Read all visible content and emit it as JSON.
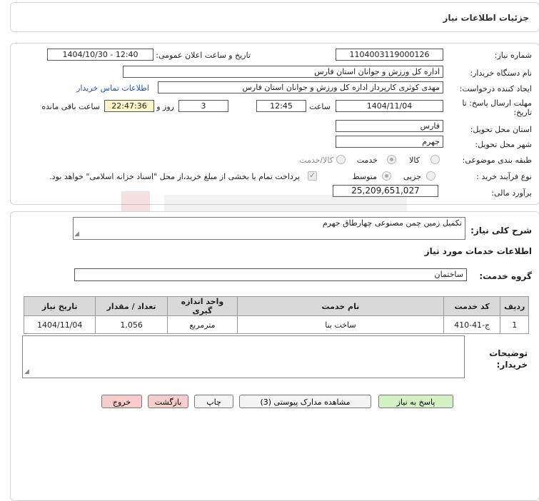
{
  "header": {
    "title": "جزئیات اطلاعات نیاز"
  },
  "form": {
    "need_number_label": "شماره نیاز:",
    "need_number": "1104003119000126",
    "announce_label": "تاریخ و ساعت اعلان عمومی:",
    "announce_value": "1404/10/30 - 12:40",
    "buyer_org_label": "نام دستگاه خریدار:",
    "buyer_org": "اداره کل ورزش و جوانان استان فارس",
    "creator_label": "ایجاد کننده درخواست:",
    "creator": "مهدی کوثری کارپرداز اداره کل ورزش و جوانان استان فارس",
    "contact_link": "اطلاعات تماس خریدار",
    "deadline_label_1": "مهلت ارسال پاسخ: تا",
    "deadline_label_2": "تاریخ:",
    "deadline_date": "1404/11/04",
    "time_label": "ساعت",
    "deadline_time": "12:45",
    "days_value": "3",
    "days_label": "روز و",
    "remaining_time": "22:47:36",
    "remaining_label": "ساعت باقی مانده",
    "province_label": "استان محل تحویل:",
    "province": "فارس",
    "city_label": "شهر محل تحویل:",
    "city": "جهرم",
    "category_label": "طبقه بندی موضوعی:",
    "category_options": [
      "کالا",
      "خدمت",
      "کالا/خدمت"
    ],
    "process_label": "نوع فرآیند خرید :",
    "process_options": [
      "جزیی",
      "متوسط"
    ],
    "payment_note": "پرداخت تمام یا بخشی از مبلغ خرید،از محل \"اسناد خزانه اسلامی\" خواهد بود.",
    "budget_label": "برآورد مالی:",
    "budget": "25,209,651,027"
  },
  "description": {
    "label": "شرح کلی نیاز:",
    "value": "تکمیل زمین چمن مصنوعی چهارطاق جهرم"
  },
  "services": {
    "section_title": "اطلاعات خدمات مورد نیاز",
    "group_label": "گروه خدمت:",
    "group_value": "ساختمان",
    "columns": [
      "ردیف",
      "کد خدمت",
      "نام خدمت",
      "واحد اندازه گیری",
      "تعداد / مقدار",
      "تاریخ نیاز"
    ],
    "rows": [
      [
        "1",
        "ج-41-410",
        "ساخت بنا",
        "مترمربع",
        "1,056",
        "1404/11/04"
      ]
    ]
  },
  "buyer_notes": {
    "label_1": "توضیحات",
    "label_2": "خریدار:"
  },
  "buttons": {
    "reply": "پاسخ به نیاز",
    "attachments": "مشاهده مدارک پیوستی (3)",
    "print": "چاپ",
    "back": "بازگشت",
    "exit": "خروج"
  },
  "colors": {
    "reply_bg": "#d6f0c6",
    "exit_bg": "#f6cccc",
    "remaining_bg": "#fbf4c6",
    "link": "#1a56c4"
  }
}
